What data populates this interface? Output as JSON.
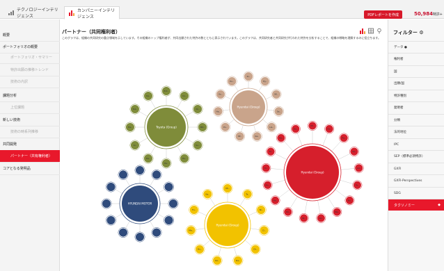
{
  "tabs": [
    {
      "label": "テクノロジーインテリジェンス"
    },
    {
      "label": "カンパニーインテリジェンス"
    }
  ],
  "header": {
    "pdf_button": "PDFレポートを作成",
    "patent_count": "50,984",
    "patent_suffix": "特許+"
  },
  "sidebar": {
    "items": [
      {
        "label": "概要",
        "kind": "head"
      },
      {
        "label": "ポートフォリオの概要",
        "kind": "head"
      },
      {
        "label": "ポートフォリオ・サマリー",
        "kind": "sub"
      },
      {
        "label": "特許出願の推移トレンド",
        "kind": "sub"
      },
      {
        "label": "技術の内訳",
        "kind": "sub"
      },
      {
        "label": "課題分析",
        "kind": "head"
      },
      {
        "label": "上位課題",
        "kind": "sub"
      },
      {
        "label": "新しい技術",
        "kind": "head"
      },
      {
        "label": "技術の時系列推移",
        "kind": "sub"
      },
      {
        "label": "共同開発",
        "kind": "head"
      },
      {
        "label": "パートナー（共有権利者）",
        "kind": "active"
      },
      {
        "label": "コアとなる発明品",
        "kind": "head"
      }
    ]
  },
  "main": {
    "title": "パートナー（共同権利者）",
    "description": "このグラフは、組織の共同研究の重点領域を示しています。その組織のトップ権利者が、共同出願された特許の数とともに表示されています。このグラフは、共同研究者と共同研究が行われた特許を分析することで、組織の戦略を理解するのに役立ちます。"
  },
  "filters": {
    "title": "フィルター",
    "items": [
      {
        "label": "データ"
      },
      {
        "label": "権利者"
      },
      {
        "label": "国"
      },
      {
        "label": "出願/国"
      },
      {
        "label": "特許種別"
      },
      {
        "label": "発明者"
      },
      {
        "label": "分類"
      },
      {
        "label": "法的地位"
      },
      {
        "label": "IPC"
      },
      {
        "label": "SEP（標準必須特許）"
      },
      {
        "label": "GXFI"
      },
      {
        "label": "GXFI-Perspectives"
      },
      {
        "label": "SDG"
      },
      {
        "label": "タクソノミー"
      }
    ]
  },
  "clusters": [
    {
      "center": "Toyota (Group)",
      "color": "#7f8c3a",
      "nodes": [
        "Ent..",
        "Co..",
        "Ni..",
        "Mit..",
        "Su..",
        "Ho..",
        "Pa..",
        "De..",
        "Ai..",
        "Ha..",
        "Tok..",
        "Ka.."
      ]
    },
    {
      "center": "Hyundai (Group)",
      "color": "#c9a48b",
      "nodes": [
        "Ki..",
        "Hy..",
        "SK..",
        "Sa..",
        "LG..",
        "Ka..",
        "SE..",
        "Po..",
        "Ha..",
        "Ko..",
        "Pu.."
      ]
    },
    {
      "center": "Hyundai (Group)",
      "color": "#d61f2c",
      "nodes": [
        "Mi..",
        "Do..",
        "Pa..",
        "Sa..",
        "Ad..",
        "Te..",
        "Bo..",
        "Ma..",
        "Ko..",
        "Ni..",
        "Sh..",
        "Ha..",
        "Mo..",
        "To..",
        "Ei..",
        "Ra..",
        "Da.."
      ]
    },
    {
      "center": "HYUNDAI MOTOR",
      "color": "#2f4b7c",
      "nodes": [
        "",
        "",
        "",
        "",
        "",
        "",
        "",
        "",
        "",
        "",
        "",
        ""
      ]
    },
    {
      "center": "Hyundai (Group)",
      "color": "#f2c200",
      "nodes": [
        "Mi..",
        "Ts..",
        "Ni..",
        "Ci..",
        "Ch..",
        "Da..",
        "KA..",
        "Ho..",
        "Ma..",
        "Fu..",
        "Ka.."
      ]
    }
  ],
  "colors": {
    "accent": "#e8182b"
  }
}
